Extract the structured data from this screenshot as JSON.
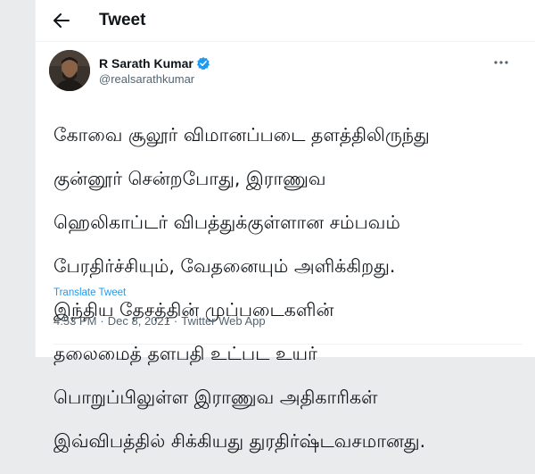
{
  "header": {
    "title": "Tweet",
    "back_icon": "arrow-left-icon"
  },
  "author": {
    "display_name": "R Sarath Kumar",
    "handle": "@realsarathkumar",
    "verified": true,
    "verified_color": "#1d9bf0"
  },
  "tweet": {
    "lines": [
      "கோவை சூலூர் விமானப்படை தளத்திலிருந்து",
      "குன்னூர் சென்றபோது,  இராணுவ",
      "ஹெலிகாப்டர் விபத்துக்குள்ளான சம்பவம்",
      "பேரதிர்ச்சியும், வேதனையும் அளிக்கிறது.",
      "இந்திய தேசத்தின் முப்படைகளின்",
      "தலைமைத் தளபதி உட்பட உயர்",
      "பொறுப்பிலுள்ள இராணுவ அதிகாரிகள்",
      "இவ்விபத்தில் சிக்கியது துரதிர்ஷ்டவசமானது."
    ],
    "translate_label": "Translate Tweet"
  },
  "meta": {
    "time": "4:53 PM",
    "separator": "·",
    "date": "Dec 8, 2021",
    "source": "Twitter Web App"
  },
  "colors": {
    "link": "#1d9bf0",
    "secondary_text": "#536471",
    "primary_text": "#0f1419",
    "page_background": "#e9ebec"
  }
}
